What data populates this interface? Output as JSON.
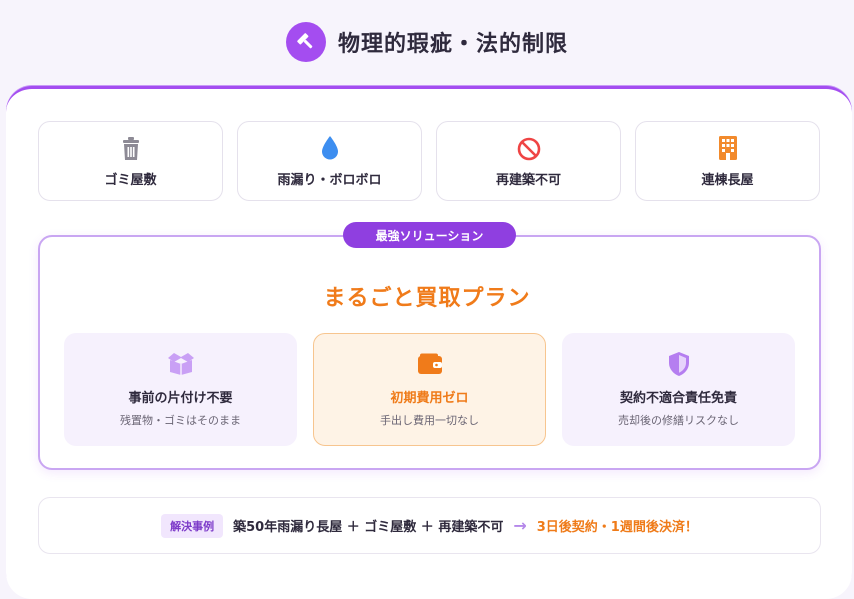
{
  "header": {
    "title": "物理的瑕疵・法的制限",
    "icon": "hammer-icon"
  },
  "categories": [
    {
      "label": "ゴミ屋敷",
      "icon": "trash-icon",
      "color": "#8d8a95"
    },
    {
      "label": "雨漏り・ボロボロ",
      "icon": "water-drop-icon",
      "color": "#3d8ef0"
    },
    {
      "label": "再建築不可",
      "icon": "prohibited-icon",
      "color": "#ef4444"
    },
    {
      "label": "連棟長屋",
      "icon": "building-icon",
      "color": "#f28a2c"
    }
  ],
  "solution": {
    "badge": "最強ソリューション",
    "plan_title": "まるごと買取プラン",
    "features": [
      {
        "title": "事前の片付け不要",
        "subtitle": "残置物・ゴミはそのまま",
        "icon": "box-icon"
      },
      {
        "title": "初期費用ゼロ",
        "subtitle": "手出し費用一切なし",
        "icon": "wallet-icon"
      },
      {
        "title": "契約不適合責任免責",
        "subtitle": "売却後の修繕リスクなし",
        "icon": "shield-icon"
      }
    ]
  },
  "case": {
    "tag": "解決事例",
    "text": "築50年雨漏り長屋 ＋ ゴミ屋敷 ＋ 再建築不可",
    "arrow": "→",
    "result": "3日後契約・1週間後決済！"
  },
  "colors": {
    "accent": "#a44df0",
    "orange": "#f07b1a",
    "text": "#2f2a3d"
  }
}
